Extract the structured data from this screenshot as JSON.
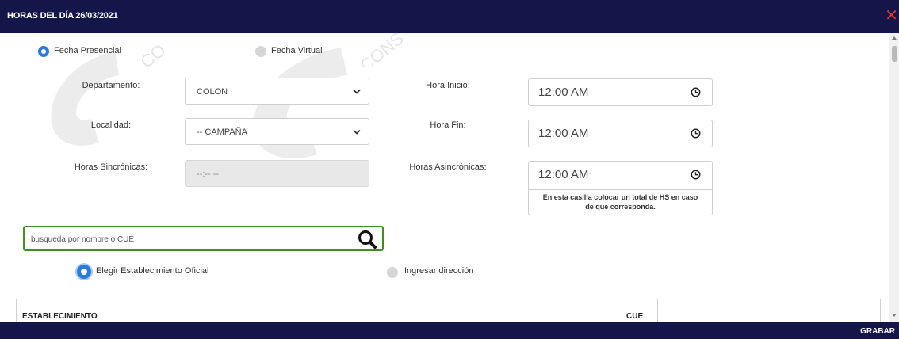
{
  "dialog": {
    "title": "HORAS DEL DÍA 26/03/2021",
    "close_symbol": "✕"
  },
  "mode": {
    "presencial_label": "Fecha Presencial",
    "virtual_label": "Fecha Virtual",
    "selected": "presencial"
  },
  "form": {
    "departamento_label": "Departamento:",
    "departamento_value": "COLON",
    "localidad_label": "Localidad:",
    "localidad_value": "-- CAMPAÑA",
    "horas_sincronicas_label": "Horas Sincrónicas:",
    "horas_sincronicas_value": "--:-- --",
    "hora_inicio_label": "Hora Inicio:",
    "hora_inicio_value": "12:00 AM",
    "hora_fin_label": "Hora Fin:",
    "hora_fin_value": "12:00 AM",
    "horas_asincronicas_label": "Horas Asincrónicas:",
    "horas_asincronicas_value": "12:00 AM",
    "horas_asincronicas_hint_line1": "En esta casilla colocar un total de HS en caso",
    "horas_asincronicas_hint_line2": "de que corresponda."
  },
  "search": {
    "placeholder": "busqueda por nombre o CUE"
  },
  "location_mode": {
    "official_label": "Elegir Establecimiento Oficial",
    "address_label": "Ingresar dirección",
    "selected": "official"
  },
  "table": {
    "columns": [
      "ESTABLECIMIENTO",
      "CUE",
      ""
    ]
  },
  "footer": {
    "save_label": "GRABAR"
  },
  "colors": {
    "header_bg": "#14164a",
    "accent_blue": "#2a7bdb",
    "search_border": "#3f8f23",
    "close_red": "#d9382b"
  },
  "icons": [
    "close-icon",
    "chevron-down-icon",
    "clock-icon",
    "search-icon"
  ]
}
